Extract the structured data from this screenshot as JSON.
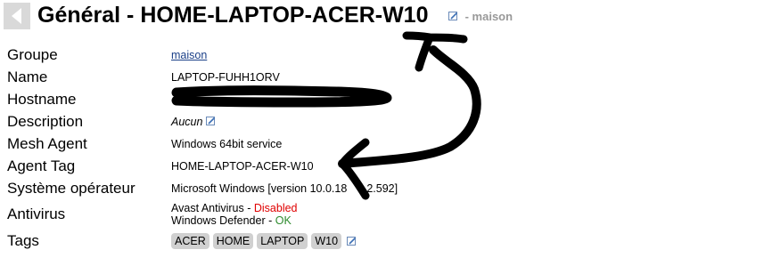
{
  "header": {
    "title": "Général - HOME-LAPTOP-ACER-W10",
    "group_suffix": " - maison",
    "back_icon": "back-arrow-icon",
    "edit_icon": "pencil-edit-icon"
  },
  "fields": {
    "groupe": {
      "label": "Groupe",
      "value": "maison"
    },
    "name": {
      "label": "Name",
      "value": "LAPTOP-FUHH1ORV"
    },
    "hostname": {
      "label": "Hostname",
      "value": ""
    },
    "description": {
      "label": "Description",
      "value": "Aucun"
    },
    "mesh_agent": {
      "label": "Mesh Agent",
      "value": "Windows 64bit service"
    },
    "agent_tag": {
      "label": "Agent Tag",
      "value": "HOME-LAPTOP-ACER-W10"
    },
    "os": {
      "label": "Système opérateur",
      "value": "Microsoft Windows [version 10.0.18",
      "value_tail": "2.592]"
    },
    "antivirus": {
      "label": "Antivirus",
      "items": [
        {
          "name": "Avast Antivirus",
          "separator": " - ",
          "status": "Disabled"
        },
        {
          "name": "Windows Defender",
          "separator": " - ",
          "status": "OK"
        }
      ]
    },
    "tags": {
      "label": "Tags",
      "items": [
        "ACER",
        "HOME",
        "LAPTOP",
        "W10"
      ]
    }
  },
  "colors": {
    "link": "#1a3f88",
    "disabled": "#e00000",
    "ok": "#2e8b2e",
    "tag_bg": "#d0d0d0",
    "muted": "#999999",
    "annotation": "#000000"
  }
}
